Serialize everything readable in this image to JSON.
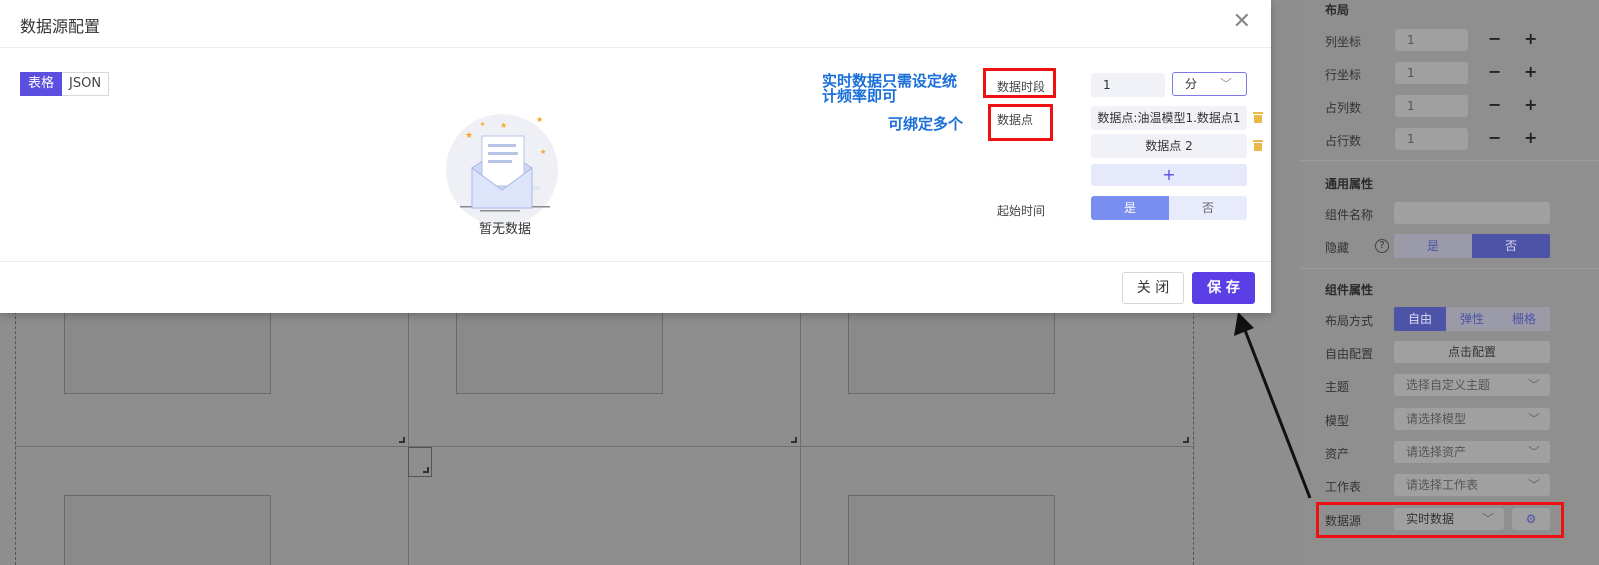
{
  "modal": {
    "title": "数据源配置",
    "close_icon": "close-icon",
    "tabs": [
      {
        "label": "表格",
        "active": true
      },
      {
        "label": "JSON",
        "active": false
      }
    ],
    "empty_text": "暂无数据",
    "annotations": {
      "time_note_line1": "实时数据只需设定统",
      "time_note_line2": "计频率即可",
      "points_note": "可绑定多个"
    },
    "form": {
      "period_label": "数据时段",
      "period_value": "1",
      "period_unit": "分",
      "points_label": "数据点",
      "points": [
        "数据点:油温模型1.数据点1",
        "数据点 2"
      ],
      "add_label": "+",
      "start_time_label": "起始时间",
      "start_yes": "是",
      "start_no": "否"
    },
    "footer": {
      "close_label": "关 闭",
      "save_label": "保 存"
    }
  },
  "panel": {
    "layout_title": "布局",
    "layout_rows": [
      {
        "label": "列坐标",
        "value": "1"
      },
      {
        "label": "行坐标",
        "value": "1"
      },
      {
        "label": "占列数",
        "value": "1"
      },
      {
        "label": "占行数",
        "value": "1"
      }
    ],
    "minus": "−",
    "plus": "+",
    "general_title": "通用属性",
    "name_label": "组件名称",
    "hidden_label": "隐藏",
    "hidden_help": "?",
    "hidden_yes": "是",
    "hidden_no": "否",
    "component_title": "组件属性",
    "layout_mode_label": "布局方式",
    "layout_modes": [
      "自由",
      "弹性",
      "栅格"
    ],
    "free_config_label": "自由配置",
    "free_config_button": "点击配置",
    "theme_label": "主题",
    "theme_placeholder": "选择自定义主题",
    "model_label": "模型",
    "model_placeholder": "请选择模型",
    "asset_label": "资产",
    "asset_placeholder": "请选择资产",
    "sheet_label": "工作表",
    "sheet_placeholder": "请选择工作表",
    "datasource_label": "数据源",
    "datasource_value": "实时数据"
  }
}
